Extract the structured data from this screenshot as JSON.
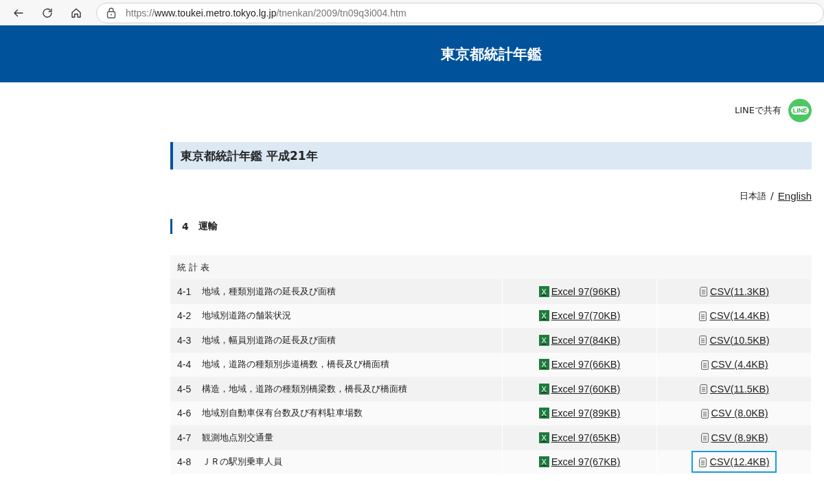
{
  "browser": {
    "url": {
      "scheme": "https://",
      "host": "www.toukei.metro.tokyo.lg.jp",
      "path": "/tnenkan/2009/tn09q3i004.htm"
    }
  },
  "header": {
    "title": "東京都統計年鑑"
  },
  "share": {
    "label": "LINEで共有",
    "logo_text": "LINE"
  },
  "page_title": "東京都統計年鑑 平成21年",
  "languages": [
    {
      "label": "日本語",
      "link": false
    },
    {
      "label": "English",
      "link": true
    }
  ],
  "language_separator": "/",
  "section": {
    "number": "4",
    "title": "運輸"
  },
  "table": {
    "heading": "統 計 表",
    "rows": [
      {
        "code": "4-1",
        "title": "地域，種類別道路の延長及び面積",
        "excel_icon": "X",
        "excel": "Excel 97(96KB)",
        "csv": "CSV(11.3KB)",
        "focused": false
      },
      {
        "code": "4-2",
        "title": "地域別道路の舗装状況",
        "excel_icon": "X",
        "excel": "Excel 97(70KB)",
        "csv": "CSV(14.4KB)",
        "focused": false
      },
      {
        "code": "4-3",
        "title": "地域，幅員別道路の延長及び面積",
        "excel_icon": "X",
        "excel": "Excel 97(84KB)",
        "csv": "CSV(10.5KB)",
        "focused": false
      },
      {
        "code": "4-4",
        "title": "地域，道路の種類別歩道橋数，橋長及び橋面積",
        "excel_icon": "X",
        "excel": "Excel 97(66KB)",
        "csv": "CSV (4.4KB)",
        "focused": false
      },
      {
        "code": "4-5",
        "title": "構造，地域，道路の種類別橋梁数，橋長及び橋面積",
        "excel_icon": "X",
        "excel": "Excel 97(60KB)",
        "csv": "CSV(11.5KB)",
        "focused": false
      },
      {
        "code": "4-6",
        "title": "地域別自動車保有台数及び有料駐車場数",
        "excel_icon": "X",
        "excel": "Excel 97(89KB)",
        "csv": "CSV (8.0KB)",
        "focused": false
      },
      {
        "code": "4-7",
        "title": "観測地点別交通量",
        "excel_icon": "X",
        "excel": "Excel 97(65KB)",
        "csv": "CSV (8.9KB)",
        "focused": false
      },
      {
        "code": "4-8",
        "title": "ＪＲの駅別乗車人員",
        "excel_icon": "X",
        "excel": "Excel 97(67KB)",
        "csv": "CSV(12.4KB)",
        "focused": true
      }
    ]
  }
}
